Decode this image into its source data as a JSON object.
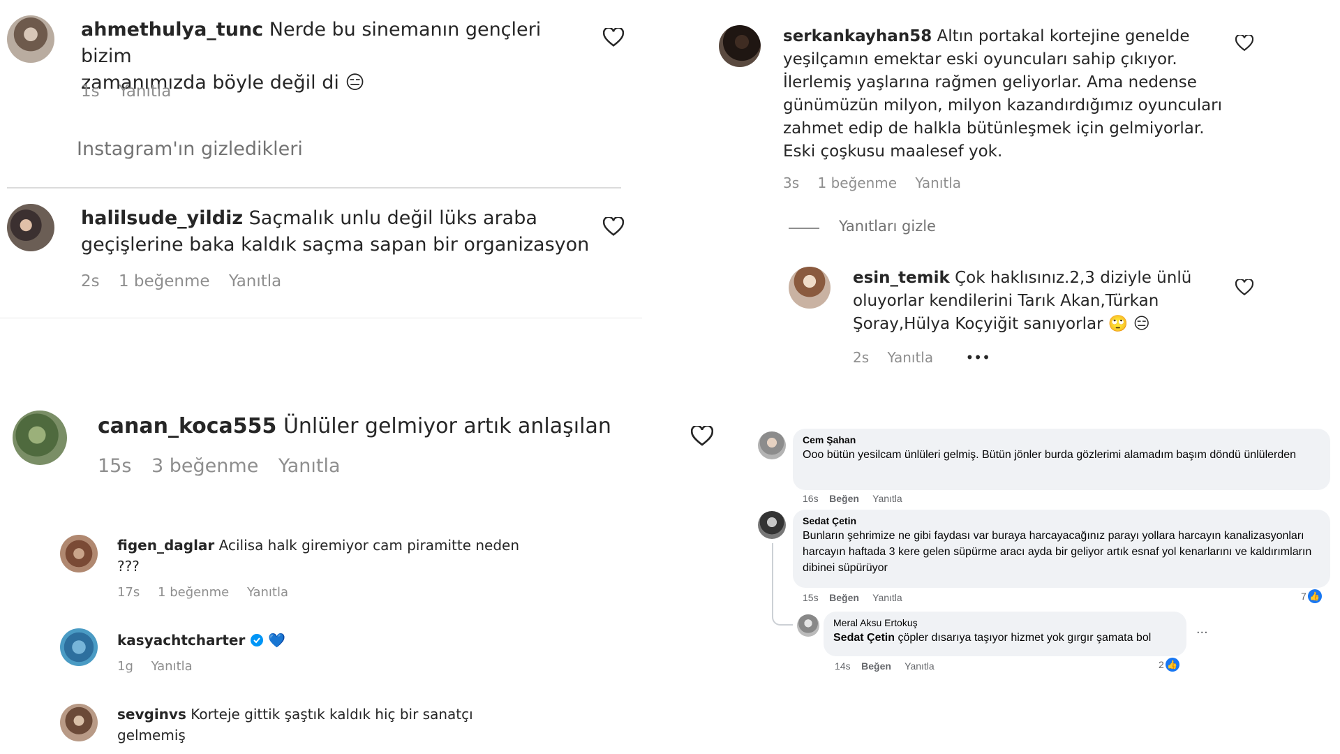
{
  "colors": {
    "ig_text": "#262626",
    "ig_meta": "#8e8e8e",
    "fb_bubble": "#f0f2f5",
    "fb_like": "#1877f2",
    "verified": "#0095f6",
    "blue_heart": "#3897f0"
  },
  "ig_top_left": {
    "c1": {
      "user": "ahmethulya_tunc",
      "text_line1": "Nerde bu sinemanın gençleri bizim",
      "text_line2": "zamanımızda böyle değil di",
      "emoji": "😑",
      "time": "1s",
      "reply": "Yanıtla"
    },
    "hidden": "Instagram'ın gizledikleri",
    "c2": {
      "user": "halilsude_yildiz",
      "text_line1": "Saçmalık unlu değil lüks araba",
      "text_line2": "geçişlerine baka kaldık saçma sapan bir organizasyon",
      "time": "2s",
      "likes": "1 beğenme",
      "reply": "Yanıtla"
    }
  },
  "ig_top_right": {
    "c1": {
      "user": "serkankayhan58",
      "lines": [
        "Altın portakal kortejine genelde",
        "yeşilçamın emektar eski oyuncuları sahip çıkıyor.",
        "İlerlemiş yaşlarına rağmen geliyorlar. Ama nedense",
        "günümüzün milyon, milyon kazandırdığımız oyuncuları",
        "zahmet edip de halkla bütünleşmek için gelmiyorlar.",
        "Eski çoşkusu maalesef yok."
      ],
      "time": "3s",
      "likes": "1 beğenme",
      "reply": "Yanıtla"
    },
    "hide_replies": "Yanıtları gizle",
    "c2": {
      "user": "esin_temik",
      "lines": [
        "Çok haklısınız.2,3 diziyle ünlü",
        "oluyorlar kendilerini Tarık Akan,Türkan",
        "Şoray,Hülya Koçyiğit sanıyorlar"
      ],
      "emoji1": "🙄",
      "emoji2": "😑",
      "time": "2s",
      "reply": "Yanıtla",
      "more": "•••"
    }
  },
  "ig_bottom_left": {
    "c1": {
      "user": "canan_koca555",
      "text": "Ünlüler gelmiyor artık anlaşılan",
      "time": "15s",
      "likes": "3 beğenme",
      "reply": "Yanıtla"
    },
    "c2": {
      "user": "figen_daglar",
      "text_line1": "Acilisa halk giremiyor cam piramitte neden",
      "text_line2": "???",
      "time": "17s",
      "likes": "1 beğenme",
      "reply": "Yanıtla"
    },
    "c3": {
      "user": "kasyachtcharter",
      "emoji": "💙",
      "time": "1g",
      "reply": "Yanıtla"
    },
    "c4": {
      "user": "sevginvs",
      "text_line1": "Korteje gittik şaştık kaldık hiç bir sanatçı",
      "text_line2": "gelmemiş"
    }
  },
  "fb": {
    "c1": {
      "name": "Cem Şahan",
      "text": "Ooo bütün yesilcam ünlüleri gelmiş. Bütün jönler burda gözlerimi alamadım başım döndü ünlülerden",
      "time": "16s",
      "like": "Beğen",
      "reply": "Yanıtla"
    },
    "c2": {
      "name": "Sedat Çetin",
      "text": "Bunların şehrimize ne gibi faydası var buraya harcayacağınız parayı yollara harcayın kanalizasyonları harcayın haftada 3 kere gelen süpürme aracı ayda bir geliyor artık esnaf yol kenarlarını ve kaldırımların dibinei süpürüyor",
      "time": "15s",
      "like": "Beğen",
      "reply": "Yanıtla",
      "like_count": "7"
    },
    "c3": {
      "name": "Meral Aksu Ertokuş",
      "mention": "Sedat Çetin",
      "text": "çöpler dısarıya taşıyor hizmet yok gırgır şamata bol",
      "time": "14s",
      "like": "Beğen",
      "reply": "Yanıtla",
      "like_count": "2",
      "more": "..."
    }
  }
}
